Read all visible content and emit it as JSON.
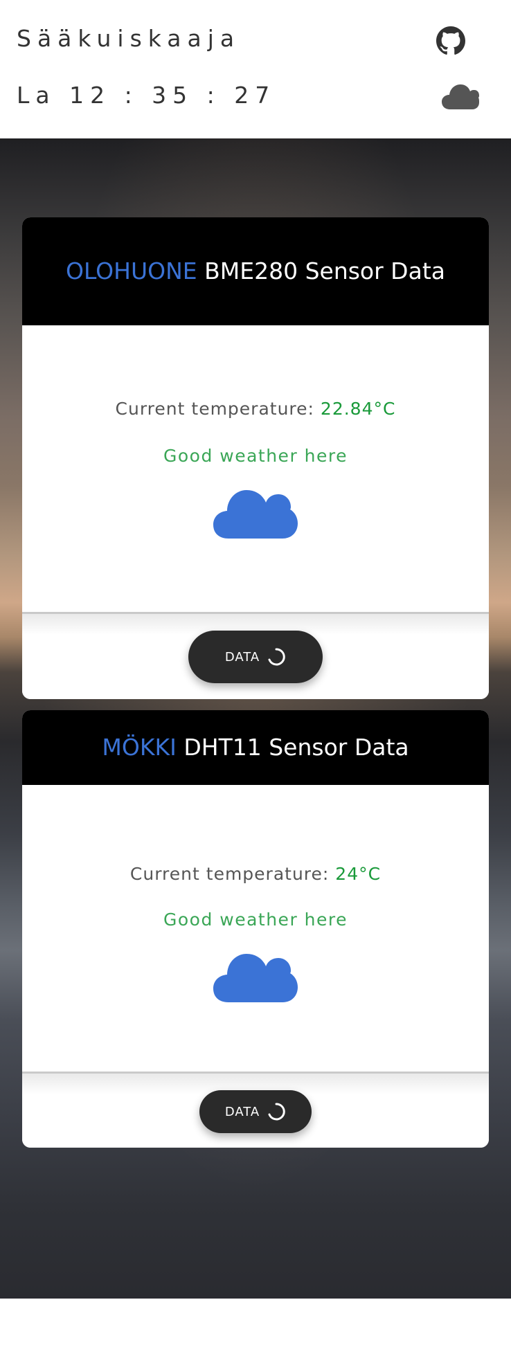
{
  "header": {
    "brand": "Sääkuiskaaja",
    "clock": "La 12 : 35 : 27",
    "github_icon": "github-icon",
    "weather_icon": "cloud-icon"
  },
  "cards": [
    {
      "location": "OLOHUONE",
      "title_rest": "BME280 Sensor Data",
      "temp_label": "Current temperature:",
      "temp_value": "22.84°C",
      "weather_text": "Good weather here",
      "weather_icon": "cloud-icon",
      "button_label": "DATA",
      "button_icon": "spinner-icon"
    },
    {
      "location": "MÖKKI",
      "title_rest": "DHT11 Sensor Data",
      "temp_label": "Current temperature:",
      "temp_value": "24°C",
      "weather_text": "Good weather here",
      "weather_icon": "cloud-icon",
      "button_label": "DATA",
      "button_icon": "spinner-icon"
    }
  ],
  "colors": {
    "location": "#3b73d6",
    "temp_value": "#1a9a3a",
    "weather_text": "#3aa656",
    "cloud_blue": "#3b73d6",
    "button_bg": "#2a2a2a"
  }
}
